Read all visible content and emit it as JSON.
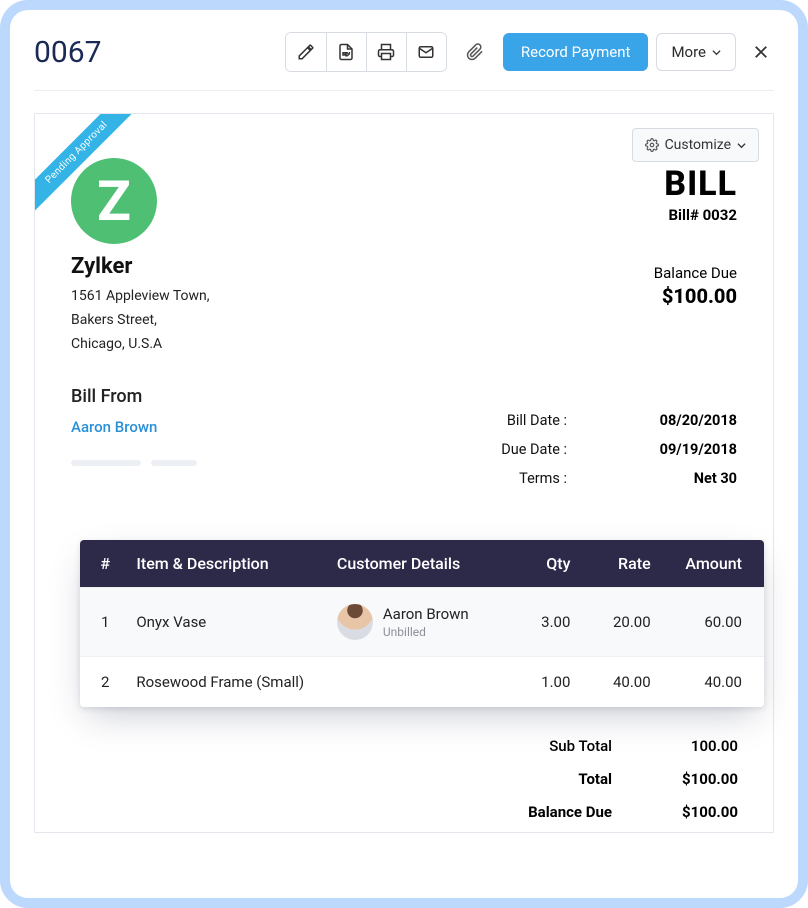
{
  "header": {
    "page_number": "0067",
    "record_label": "Record Payment",
    "more_label": "More"
  },
  "ribbon": "Pending Approval",
  "customize_label": "Customize",
  "company": {
    "logo_letter": "Z",
    "name": "Zylker",
    "address_line1": "1561 Appleview Town,",
    "address_line2": "Bakers Street,",
    "address_line3": "Chicago, U.S.A"
  },
  "bill": {
    "title": "BILL",
    "number_label": "Bill# 0032",
    "balance_label": "Balance Due",
    "balance_amount": "$100.00"
  },
  "bill_from": {
    "heading": "Bill From",
    "vendor": "Aaron Brown"
  },
  "dates": {
    "bill_date_label": "Bill Date :",
    "bill_date": "08/20/2018",
    "due_date_label": "Due Date :",
    "due_date": "09/19/2018",
    "terms_label": "Terms :",
    "terms": "Net 30"
  },
  "table": {
    "headers": {
      "num": "#",
      "item": "Item & Description",
      "customer": "Customer Details",
      "qty": "Qty",
      "rate": "Rate",
      "amount": "Amount"
    },
    "rows": [
      {
        "num": "1",
        "item": "Onyx Vase",
        "customer_name": "Aaron Brown",
        "customer_status": "Unbilled",
        "qty": "3.00",
        "rate": "20.00",
        "amount": "60.00"
      },
      {
        "num": "2",
        "item": "Rosewood Frame (Small)",
        "customer_name": "",
        "customer_status": "",
        "qty": "1.00",
        "rate": "40.00",
        "amount": "40.00"
      }
    ]
  },
  "totals": {
    "subtotal_label": "Sub Total",
    "subtotal": "100.00",
    "total_label": "Total",
    "total": "$100.00",
    "balance_label": "Balance Due",
    "balance": "$100.00"
  }
}
